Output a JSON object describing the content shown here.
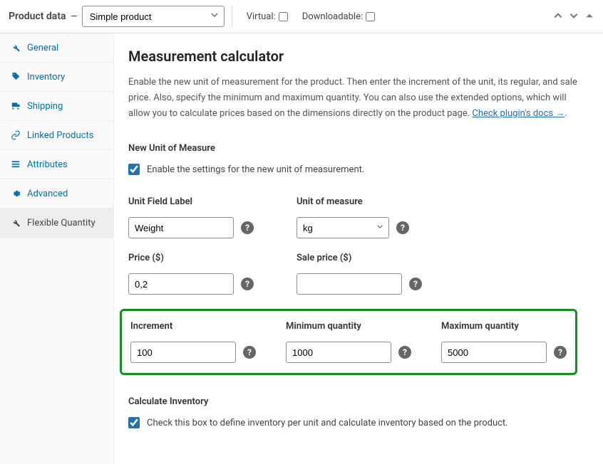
{
  "header": {
    "title": "Product data",
    "product_type": "Simple product",
    "virtual_label": "Virtual:",
    "downloadable_label": "Downloadable:"
  },
  "sidebar": {
    "items": [
      {
        "label": "General"
      },
      {
        "label": "Inventory"
      },
      {
        "label": "Shipping"
      },
      {
        "label": "Linked Products"
      },
      {
        "label": "Attributes"
      },
      {
        "label": "Advanced"
      },
      {
        "label": "Flexible Quantity"
      }
    ]
  },
  "main": {
    "heading": "Measurement calculator",
    "description_1": "Enable the new unit of measurement for the product. Then enter the increment of the unit, its regular, and sale price. Also, specify the minimum and maximum quantity. You can also use the extended options, which will allow you to calculate prices based on the dimensions directly on the product page. ",
    "docs_link": "Check plugin's docs →",
    "docs_suffix": ".",
    "new_unit_label": "New Unit of Measure",
    "enable_label": "Enable the settings for the new unit of measurement.",
    "unit_field_label": "Unit Field Label",
    "unit_field_value": "Weight",
    "unit_of_measure_label": "Unit of measure",
    "unit_of_measure_value": "kg",
    "price_label": "Price ($)",
    "price_value": "0,2",
    "sale_price_label": "Sale price ($)",
    "sale_price_value": "",
    "increment_label": "Increment",
    "increment_value": "100",
    "min_qty_label": "Minimum quantity",
    "min_qty_value": "1000",
    "max_qty_label": "Maximum quantity",
    "max_qty_value": "5000",
    "calc_inventory_label": "Calculate Inventory",
    "calc_inventory_desc": "Check this box to define inventory per unit and calculate inventory based on the product."
  }
}
